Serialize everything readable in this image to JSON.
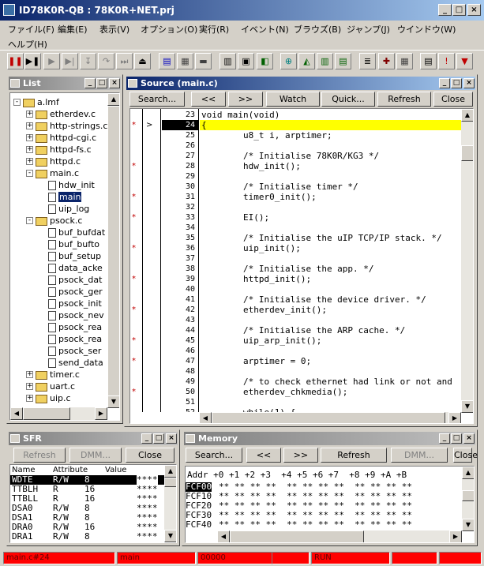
{
  "window": {
    "title": "ID78K0R-QB : 78K0R+NET.prj",
    "min": "_",
    "max": "□",
    "close": "×"
  },
  "menu": [
    "ファイル(F)",
    "編集(E)",
    "表示(V)",
    "オプション(O)",
    "実行(R)",
    "イベント(N)",
    "ブラウズ(B)",
    "ジャンプ(J)",
    "ウインドウ(W)",
    "ヘルプ(H)"
  ],
  "toolbar": [
    {
      "icon": "stop-icon",
      "glyph": "❚❚",
      "color": "#c00000"
    },
    {
      "icon": "go-icon",
      "glyph": "▶❚",
      "color": "#000"
    },
    {
      "icon": "run-icon",
      "glyph": "▶",
      "color": "#808080"
    },
    {
      "icon": "step-icon",
      "glyph": "▶|",
      "color": "#808080"
    },
    {
      "icon": "step-in-icon",
      "glyph": "↧",
      "color": "#808080"
    },
    {
      "icon": "step-over-icon",
      "glyph": "↷",
      "color": "#808080"
    },
    {
      "icon": "skip-icon",
      "glyph": "⏭",
      "color": "#808080"
    },
    {
      "icon": "eject-icon",
      "glyph": "⏏",
      "color": "#000"
    },
    {
      "icon": "source-icon",
      "glyph": "▤",
      "color": "#0000c0"
    },
    {
      "icon": "asm-icon",
      "glyph": "▦",
      "color": "#404040"
    },
    {
      "icon": "mem-icon",
      "glyph": "▬",
      "color": "#404040"
    },
    {
      "icon": "register-icon",
      "glyph": "▥",
      "color": "#000"
    },
    {
      "icon": "sfr-icon",
      "glyph": "▣",
      "color": "#000"
    },
    {
      "icon": "io-icon",
      "glyph": "◧",
      "color": "#006000"
    },
    {
      "icon": "watch-icon",
      "glyph": "⊕",
      "color": "#008080"
    },
    {
      "icon": "quick-watch-icon",
      "glyph": "◭",
      "color": "#006000"
    },
    {
      "icon": "var-icon",
      "glyph": "▥",
      "color": "#006000"
    },
    {
      "icon": "local-icon",
      "glyph": "▤",
      "color": "#006000"
    },
    {
      "icon": "stack-icon",
      "glyph": "≣",
      "color": "#000"
    },
    {
      "icon": "event-icon",
      "glyph": "✚",
      "color": "#800000"
    },
    {
      "icon": "trace-icon",
      "glyph": "▦",
      "color": "#404040"
    },
    {
      "icon": "list-icon",
      "glyph": "▤",
      "color": "#000"
    },
    {
      "icon": "break-icon",
      "glyph": "!",
      "color": "#c00000"
    },
    {
      "icon": "filter-icon",
      "glyph": "▼",
      "color": "#c00000"
    }
  ],
  "list_panel": {
    "title": "List",
    "tree": [
      {
        "label": "a.lmf",
        "level": 0,
        "type": "folder",
        "exp": "-"
      },
      {
        "label": "etherdev.c",
        "level": 1,
        "type": "folder",
        "exp": "+"
      },
      {
        "label": "http-strings.c",
        "level": 1,
        "type": "folder",
        "exp": "+"
      },
      {
        "label": "httpd-cgi.c",
        "level": 1,
        "type": "folder",
        "exp": "+"
      },
      {
        "label": "httpd-fs.c",
        "level": 1,
        "type": "folder",
        "exp": "+"
      },
      {
        "label": "httpd.c",
        "level": 1,
        "type": "folder",
        "exp": "+"
      },
      {
        "label": "main.c",
        "level": 1,
        "type": "folder",
        "exp": "-"
      },
      {
        "label": "hdw_init",
        "level": 2,
        "type": "doc"
      },
      {
        "label": "main",
        "level": 2,
        "type": "doc",
        "selected": true
      },
      {
        "label": "uip_log",
        "level": 2,
        "type": "doc"
      },
      {
        "label": "psock.c",
        "level": 1,
        "type": "folder",
        "exp": "-"
      },
      {
        "label": "buf_bufdat",
        "level": 2,
        "type": "doc"
      },
      {
        "label": "buf_bufto",
        "level": 2,
        "type": "doc"
      },
      {
        "label": "buf_setup",
        "level": 2,
        "type": "doc"
      },
      {
        "label": "data_acke",
        "level": 2,
        "type": "doc"
      },
      {
        "label": "psock_dat",
        "level": 2,
        "type": "doc"
      },
      {
        "label": "psock_ger",
        "level": 2,
        "type": "doc"
      },
      {
        "label": "psock_init",
        "level": 2,
        "type": "doc"
      },
      {
        "label": "psock_nev",
        "level": 2,
        "type": "doc"
      },
      {
        "label": "psock_rea",
        "level": 2,
        "type": "doc"
      },
      {
        "label": "psock_rea",
        "level": 2,
        "type": "doc"
      },
      {
        "label": "psock_ser",
        "level": 2,
        "type": "doc"
      },
      {
        "label": "send_data",
        "level": 2,
        "type": "doc"
      },
      {
        "label": "timer.c",
        "level": 1,
        "type": "folder",
        "exp": "+"
      },
      {
        "label": "uart.c",
        "level": 1,
        "type": "folder",
        "exp": "+"
      },
      {
        "label": "uip.c",
        "level": 1,
        "type": "folder",
        "exp": "+"
      }
    ]
  },
  "source_panel": {
    "title": "Source (main.c)",
    "buttons": [
      "Search...",
      "<<",
      ">>",
      "Watch",
      "Quick...",
      "Refresh",
      "Close"
    ],
    "lines": [
      {
        "n": "23",
        "bp": "",
        "code": "void main(void)"
      },
      {
        "n": "24",
        "bp": "*",
        "code": "{",
        "current": true
      },
      {
        "n": "25",
        "bp": "",
        "code": "        u8_t i, arptimer;"
      },
      {
        "n": "26",
        "bp": "",
        "code": ""
      },
      {
        "n": "27",
        "bp": "",
        "code": "        /* Initialise 78K0R/KG3 */"
      },
      {
        "n": "28",
        "bp": "*",
        "code": "        hdw_init();"
      },
      {
        "n": "29",
        "bp": "",
        "code": ""
      },
      {
        "n": "30",
        "bp": "",
        "code": "        /* Initialise timer */"
      },
      {
        "n": "31",
        "bp": "*",
        "code": "        timer0_init();"
      },
      {
        "n": "32",
        "bp": "",
        "code": ""
      },
      {
        "n": "33",
        "bp": "*",
        "code": "        EI();"
      },
      {
        "n": "34",
        "bp": "",
        "code": ""
      },
      {
        "n": "35",
        "bp": "",
        "code": "        /* Initialise the uIP TCP/IP stack. */"
      },
      {
        "n": "36",
        "bp": "*",
        "code": "        uip_init();"
      },
      {
        "n": "37",
        "bp": "",
        "code": ""
      },
      {
        "n": "38",
        "bp": "",
        "code": "        /* Initialise the app. */"
      },
      {
        "n": "39",
        "bp": "*",
        "code": "        httpd_init();"
      },
      {
        "n": "40",
        "bp": "",
        "code": ""
      },
      {
        "n": "41",
        "bp": "",
        "code": "        /* Initialise the device driver. */"
      },
      {
        "n": "42",
        "bp": "*",
        "code": "        etherdev_init();"
      },
      {
        "n": "43",
        "bp": "",
        "code": ""
      },
      {
        "n": "44",
        "bp": "",
        "code": "        /* Initialise the ARP cache. */"
      },
      {
        "n": "45",
        "bp": "*",
        "code": "        uip_arp_init();"
      },
      {
        "n": "46",
        "bp": "",
        "code": ""
      },
      {
        "n": "47",
        "bp": "*",
        "code": "        arptimer = 0;"
      },
      {
        "n": "48",
        "bp": "",
        "code": ""
      },
      {
        "n": "49",
        "bp": "",
        "code": "        /* to check ethernet had link or not and"
      },
      {
        "n": "50",
        "bp": "*",
        "code": "        etherdev_chkmedia();"
      },
      {
        "n": "51",
        "bp": "",
        "code": ""
      },
      {
        "n": "52",
        "bp": "",
        "code": "        while(1) {"
      }
    ]
  },
  "sfr_panel": {
    "title": "SFR",
    "buttons": [
      "Refresh",
      "DMM...",
      "Close"
    ],
    "columns": [
      "Name",
      "Attribute",
      "Value"
    ],
    "rows": [
      {
        "name": "WDTE",
        "attr": "R/W",
        "bits": "8",
        "value": "****",
        "selected": true
      },
      {
        "name": "TTBLH",
        "attr": "R",
        "bits": "16",
        "value": "****"
      },
      {
        "name": "TTBLL",
        "attr": "R",
        "bits": "16",
        "value": "****"
      },
      {
        "name": "DSA0",
        "attr": "R/W",
        "bits": "8",
        "value": "****"
      },
      {
        "name": "DSA1",
        "attr": "R/W",
        "bits": "8",
        "value": "****"
      },
      {
        "name": "DRA0",
        "attr": "R/W",
        "bits": "16",
        "value": "****"
      },
      {
        "name": "DRA1",
        "attr": "R/W",
        "bits": "8",
        "value": "****"
      }
    ]
  },
  "memory_panel": {
    "title": "Memory",
    "buttons": [
      "Search...",
      "<<",
      ">>",
      "Refresh",
      "DMM...",
      "Close"
    ],
    "header": "Addr +0 +1 +2 +3  +4 +5 +6 +7  +8 +9 +A +B",
    "rows": [
      {
        "addr": "FCF00",
        "data": "** ** ** **  ** ** ** **  ** ** ** **",
        "selected": true
      },
      {
        "addr": "FCF10",
        "data": "** ** ** **  ** ** ** **  ** ** ** **"
      },
      {
        "addr": "FCF20",
        "data": "** ** ** **  ** ** ** **  ** ** ** **"
      },
      {
        "addr": "FCF30",
        "data": "** ** ** **  ** ** ** **  ** ** ** **"
      },
      {
        "addr": "FCF40",
        "data": "** ** ** **  ** ** ** **  ** ** ** **"
      }
    ]
  },
  "status": [
    "main.c#24",
    "main",
    "00000",
    "",
    "RUN",
    "",
    ""
  ]
}
